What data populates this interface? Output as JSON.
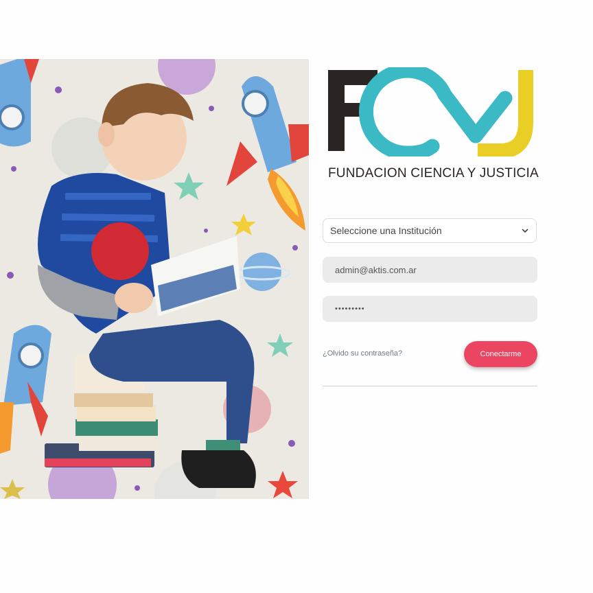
{
  "brand": {
    "tagline": "FUNDACION CIENCIA Y JUSTICIA",
    "colors": {
      "dark": "#2a2523",
      "teal": "#3bb9c4",
      "yellow": "#e9cf25"
    }
  },
  "form": {
    "institution_select": {
      "value": "Seleccione una Institución"
    },
    "email": {
      "value": "admin@aktis.com.ar"
    },
    "password": {
      "value": "•••••••••"
    },
    "forgot_password": "¿Olvido su contraseña?",
    "submit_label": "Conectarme"
  },
  "colors": {
    "accent": "#ec4561"
  }
}
